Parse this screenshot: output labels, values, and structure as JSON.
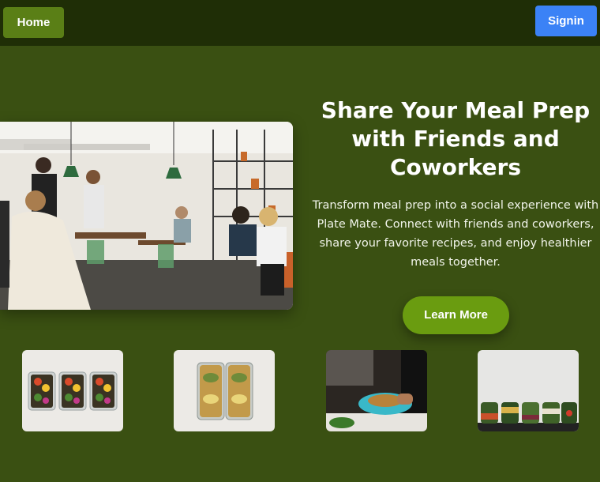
{
  "nav": {
    "home_label": "Home",
    "signin_label": "Signin"
  },
  "hero": {
    "title": "Share Your Meal Prep with Friends and Coworkers",
    "description": "Transform meal prep into a social experience with Plate Mate. Connect with friends and coworkers, share your favorite recipes, and enjoy healthier meals together.",
    "cta_label": "Learn More"
  },
  "colors": {
    "background": "#3a5012",
    "topbar": "#1f2e06",
    "home_button": "#5a7f16",
    "signin_button": "#3b82f6",
    "cta_button": "#6a9c10"
  }
}
